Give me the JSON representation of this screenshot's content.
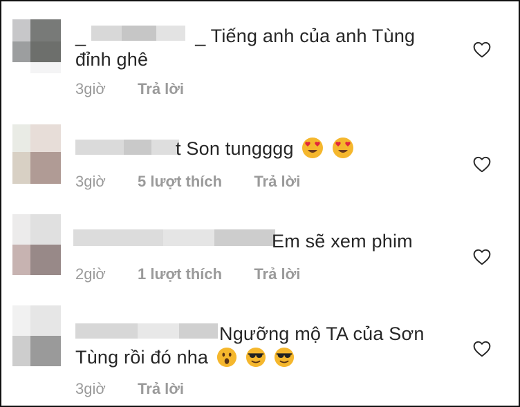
{
  "comments": [
    {
      "text_prefix": "_",
      "text_suffix": "_ Tiếng anh của anh Tùng đỉnh ghê",
      "time": "3giờ",
      "likes": "",
      "reply": "Trả lời",
      "emojis": []
    },
    {
      "text_prefix": "",
      "text_suffix": "t Son tungggg",
      "time": "3giờ",
      "likes": "5 lượt thích",
      "reply": "Trả lời",
      "emojis": [
        "heart-eyes-emoji",
        "heart-eyes-emoji"
      ]
    },
    {
      "text_prefix": "",
      "text_suffix": "Em sẽ xem phim",
      "time": "2giờ",
      "likes": "1 lượt thích",
      "reply": "Trả lời",
      "emojis": []
    },
    {
      "text_prefix": "",
      "text_suffix": "Ngưỡng mộ TA của Sơn Tùng rồi đó nha",
      "time": "3giờ",
      "likes": "",
      "reply": "Trả lời",
      "emojis": [
        "surprised-emoji",
        "sunglasses-emoji",
        "sunglasses-emoji"
      ]
    }
  ],
  "icons": {
    "like": "heart-outline-icon"
  },
  "colors": {
    "text": "#262626",
    "meta": "#9a9a9a",
    "border": "#111111"
  }
}
